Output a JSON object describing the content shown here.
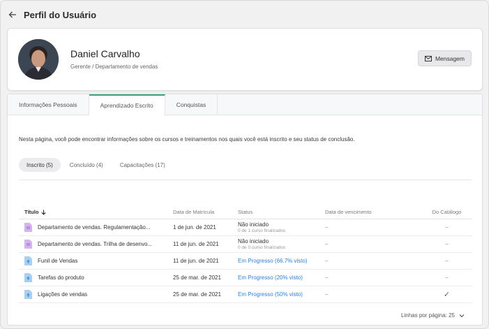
{
  "header": {
    "title": "Perfil do Usuário"
  },
  "profile": {
    "name": "Daniel Carvalho",
    "role": "Gerente / Departamento de vendas",
    "message_button": "Mensagem"
  },
  "tabs": [
    {
      "label": "Informações Pessoais"
    },
    {
      "label": "Aprendizado Escrito"
    },
    {
      "label": "Conquistas"
    }
  ],
  "intro": "Nesta página, você pode encontrar informações sobre os cursos e treinamentos nos quais você está inscrito e seu status de conclusão.",
  "subtabs": [
    {
      "label": "Inscrito (5)"
    },
    {
      "label": "Concluído (4)"
    },
    {
      "label": "Capacitações (17)"
    }
  ],
  "table": {
    "columns": {
      "title": "Título",
      "enrolled": "Data de Matrícula",
      "status": "Status",
      "due": "Data de vencimento",
      "catalog": "Do Catálogo"
    },
    "rows": [
      {
        "title": "Departamento de vendas. Regulamentação...",
        "enrolled": "1 de jun. de 2021",
        "status": "Não iniciado",
        "status_sub": "0 de 1 curso finalizados",
        "due": "–",
        "catalog": "–",
        "icon": "path-icon"
      },
      {
        "title": "Departamento de vendas. Trilha de desenvo...",
        "enrolled": "11 de jun. de 2021",
        "status": "Não iniciado",
        "status_sub": "0 de 0 curso finalizados",
        "due": "–",
        "catalog": "–",
        "icon": "path-icon"
      },
      {
        "title": "Funil de Vendas",
        "enrolled": "11 de jun. de 2021",
        "status": "Em Progresso (66.7% visto)",
        "status_sub": "",
        "due": "–",
        "catalog": "–",
        "icon": "course-icon"
      },
      {
        "title": "Tarefas do produto",
        "enrolled": "25 de mar. de 2021",
        "status": "Em Progresso (20% visto)",
        "status_sub": "",
        "due": "–",
        "catalog": "–",
        "icon": "course-icon"
      },
      {
        "title": "Ligações de vendas",
        "enrolled": "25 de mar. de 2021",
        "status": "Em Progresso (50% visto)",
        "status_sub": "",
        "due": "–",
        "catalog": "✓",
        "icon": "course-icon"
      }
    ]
  },
  "footer": {
    "rows_per_page": "Linhas por página: 25"
  },
  "colors": {
    "accent": "#36a679",
    "link": "#2f7fd0",
    "path_icon": "#c9a6e8",
    "course_icon": "#9fc9f0"
  }
}
